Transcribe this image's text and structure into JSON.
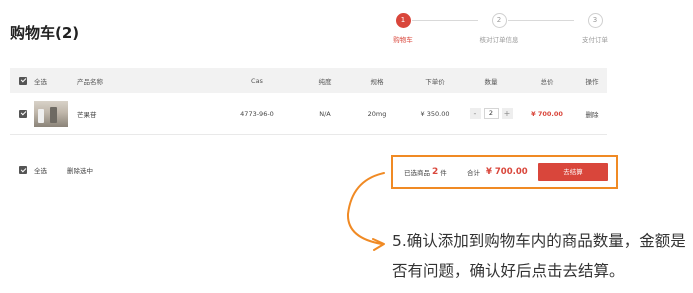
{
  "page": {
    "title": "购物车(2)"
  },
  "steps": [
    {
      "number": "1",
      "label": "购物车"
    },
    {
      "number": "2",
      "label": "核对订单信息"
    },
    {
      "number": "3",
      "label": "支付订单"
    }
  ],
  "table": {
    "headers": {
      "select_all": "全选",
      "product": "产品名称",
      "cas": "Cas",
      "purity": "纯度",
      "spec": "规格",
      "unit_price": "下单价",
      "quantity": "数量",
      "total": "总价",
      "action": "操作"
    },
    "rows": [
      {
        "product_name": "芒果苷",
        "cas": "4773-96-0",
        "purity": "N/A",
        "spec": "20mg",
        "unit_price": "¥ 350.00",
        "quantity": "2",
        "minus": "-",
        "plus": "+",
        "total": "¥ 700.00",
        "action": "删除"
      }
    ]
  },
  "footer": {
    "select_all": "全选",
    "delete_selected": "删除选中",
    "selected_prefix": "已选商品",
    "selected_count": "2",
    "selected_suffix": "件",
    "total_label": "合计",
    "total_amount": "¥ 700.00",
    "checkout": "去结算"
  },
  "annotation": {
    "text": "5.确认添加到购物车内的商品数量，金额是否有问题，确认好后点击去结算。"
  },
  "colors": {
    "accent": "#d9463b",
    "highlight": "#f08a24"
  }
}
